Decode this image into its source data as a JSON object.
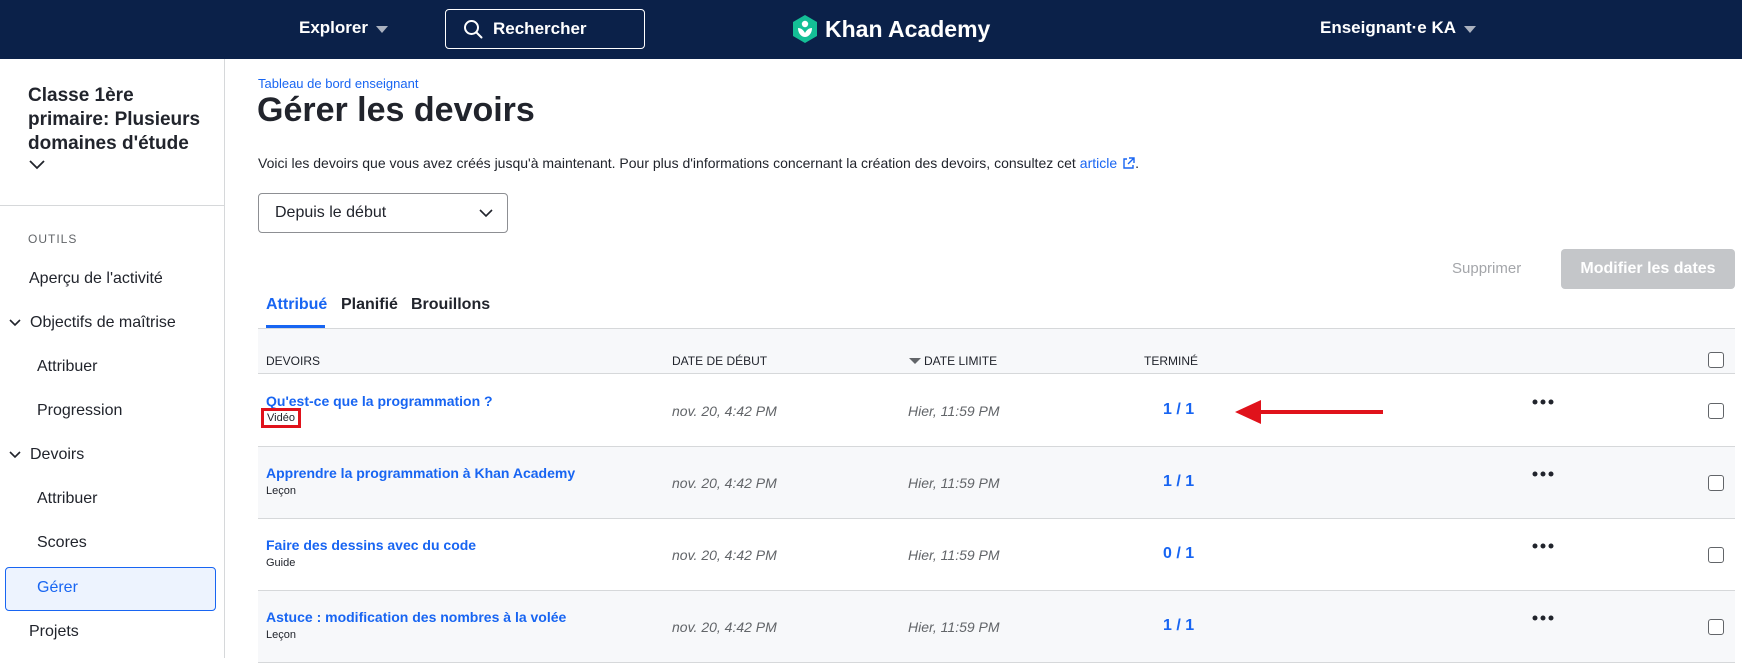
{
  "topnav": {
    "explore_label": "Explorer",
    "search_label": "Rechercher",
    "logo_text": "Khan Academy",
    "user_label": "Enseignant·e KA"
  },
  "sidebar": {
    "class_title": "Classe 1ère primaire: Plusieurs domaines d'étude",
    "tools_label": "OUTILS",
    "items": [
      {
        "label": "Aperçu de l'activité"
      },
      {
        "label": "Objectifs de maîtrise"
      },
      {
        "label": "Attribuer"
      },
      {
        "label": "Progression"
      },
      {
        "label": "Devoirs"
      },
      {
        "label": "Attribuer"
      },
      {
        "label": "Scores"
      },
      {
        "label": "Gérer"
      },
      {
        "label": "Projets"
      }
    ]
  },
  "main": {
    "breadcrumb": "Tableau de bord enseignant",
    "title": "Gérer les devoirs",
    "description": "Voici les devoirs que vous avez créés jusqu'à maintenant. Pour plus d'informations concernant la création des devoirs, consultez cet",
    "description_link": "article",
    "description_end": ".",
    "date_filter": "Depuis le début",
    "delete_label": "Supprimer",
    "edit_dates_label": "Modifier les dates",
    "tabs": [
      {
        "label": "Attribué"
      },
      {
        "label": "Planifié"
      },
      {
        "label": "Brouillons"
      }
    ],
    "table": {
      "headers": {
        "assignment": "DEVOIRS",
        "start": "DATE DE DÉBUT",
        "due": "DATE LIMITE",
        "done": "TERMINÉ"
      },
      "rows": [
        {
          "title": "Qu'est-ce que la programmation ?",
          "type": "Vidéo",
          "start": "nov. 20, 4:42 PM",
          "due": "Hier, 11:59 PM",
          "done": "1 / 1"
        },
        {
          "title": "Apprendre la programmation à Khan Academy",
          "type": "Leçon",
          "start": "nov. 20, 4:42 PM",
          "due": "Hier, 11:59 PM",
          "done": "1 / 1"
        },
        {
          "title": "Faire des dessins avec du code",
          "type": "Guide",
          "start": "nov. 20, 4:42 PM",
          "due": "Hier, 11:59 PM",
          "done": "0 / 1"
        },
        {
          "title": "Astuce : modification des nombres à la volée",
          "type": "Leçon",
          "start": "nov. 20, 4:42 PM",
          "due": "Hier, 11:59 PM",
          "done": "1 / 1"
        }
      ]
    }
  },
  "colors": {
    "nav_bg": "#0b2149",
    "link_blue": "#1865f2",
    "annotation_red": "#e0121b",
    "logo_green": "#14bf96"
  }
}
